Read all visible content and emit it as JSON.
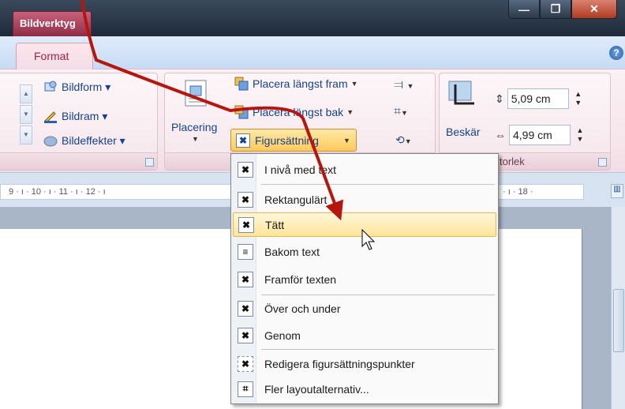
{
  "titlebar": {
    "contextual_tab": "Bildverktyg"
  },
  "window_controls": {
    "minimize": "—",
    "restore": "❐",
    "close": "✕"
  },
  "tabs": {
    "active": "Format",
    "help": "?"
  },
  "ribbon": {
    "picture_styles": {
      "shape": "Bildform ▾",
      "border": "Bildram ▾",
      "effects": "Bildeffekter ▾"
    },
    "arrange": {
      "position": "Placering",
      "bring_front": "Placera längst fram",
      "send_back": "Placera längst bak",
      "text_wrap": "Figursättning"
    },
    "size": {
      "crop": "Beskär",
      "height": "5,09 cm",
      "width": "4,99 cm",
      "label": "torlek"
    }
  },
  "ruler": {
    "text": "9 · ı · 10 · ı · 11 · ı · 12 · ı",
    "text2": "· ı · 18 ·"
  },
  "menu": {
    "items": [
      {
        "label": "I nivå med text",
        "icon": "inline-wrap-icon"
      },
      {
        "label": "Rektangulärt",
        "icon": "square-wrap-icon"
      },
      {
        "label": "Tätt",
        "icon": "tight-wrap-icon"
      },
      {
        "label": "Bakom text",
        "icon": "behind-text-icon"
      },
      {
        "label": "Framför texten",
        "icon": "in-front-icon"
      },
      {
        "label": "Över och under",
        "icon": "top-bottom-icon"
      },
      {
        "label": "Genom",
        "icon": "through-wrap-icon"
      },
      {
        "label": "Redigera figursättningspunkter",
        "icon": "edit-wrap-points-icon"
      },
      {
        "label": "Fler layoutalternativ...",
        "icon": "more-layout-icon"
      }
    ]
  },
  "colors": {
    "annotation_arrow": "#b5170f",
    "highlight": "#ffe59b",
    "contextual": "#a3223f"
  }
}
